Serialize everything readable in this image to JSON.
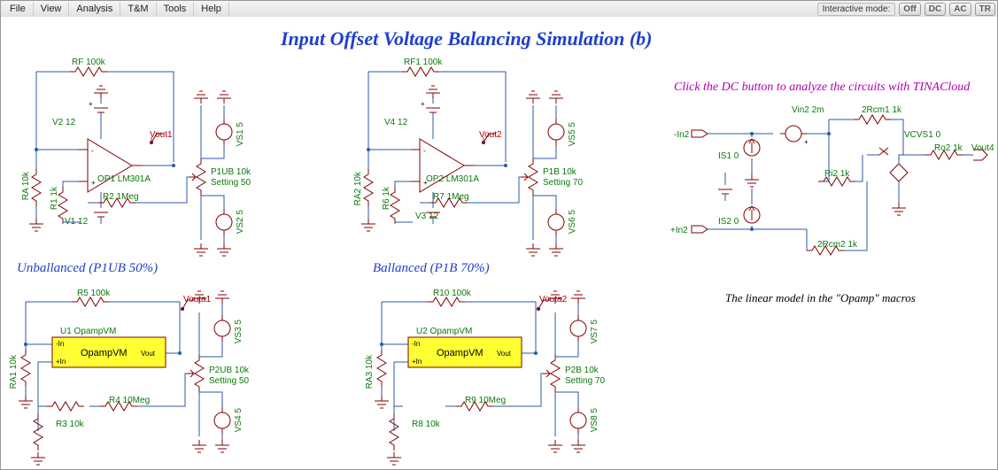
{
  "menu": {
    "items": [
      "File",
      "View",
      "Analysis",
      "T&M",
      "Tools",
      "Help"
    ]
  },
  "interactive": {
    "label": "Interactive mode:",
    "btn_off": "Off",
    "btn_dc": "DC",
    "btn_ac": "AC",
    "btn_tr": "TR"
  },
  "title": "Input Offset Voltage Balancing Simulation (b)",
  "sub_left": "Unballanced (P1UB 50%)",
  "sub_right": "Ballanced (P1B 70%)",
  "cta": "Click the DC button to analyze the circuits with TINACloud",
  "note": "The linear model in the \"Opamp\" macros",
  "q1": {
    "rf": "RF 100k",
    "v2": "V2 12",
    "v1": "V1 12",
    "op": "OP1 LM301A",
    "vout": "Vout1",
    "ra": "RA 10k",
    "r1": "R1 1k",
    "r2": "R2 1Meg",
    "p": "P1UB 10k",
    "pset": "Setting 50",
    "vs1": "VS1 5",
    "vs2": "VS2 5"
  },
  "q2": {
    "rf": "RF1 100k",
    "v4": "V4 12",
    "v3": "V3 12",
    "op": "OP2 LM301A",
    "vout": "Vout2",
    "ra": "RA2 10k",
    "r6": "R6 1k",
    "r7": "R7 1Meg",
    "p": "P1B 10k",
    "pset": "Setting 70",
    "vs5": "VS5 5",
    "vs6": "VS6 5"
  },
  "q3": {
    "r5": "R5 100k",
    "u": "U1 OpampVM",
    "vout": "Vouta1",
    "ra": "RA1 10k",
    "r4": "R4 10Meg",
    "r3": "R3 10k",
    "p": "P2UB 10k",
    "pset": "Setting 50",
    "vs3": "VS3 5",
    "vs4": "VS4 5",
    "macro": "OpampVM",
    "mpin": "Vout",
    "minm": "-In",
    "minp": "+In"
  },
  "q4": {
    "r10": "R10 100k",
    "u": "U2 OpampVM",
    "vout": "Vouta2",
    "ra": "RA3 10k",
    "r9": "R9 10Meg",
    "r8": "R8 10k",
    "p": "P2B 10k",
    "pset": "Setting 70",
    "vs7": "VS7 5",
    "vs8": "VS8 5",
    "macro": "OpampVM",
    "mpin": "Vout",
    "minm": "-In",
    "minp": "+In"
  },
  "lm": {
    "in2m": "-In2",
    "in2p": "+In2",
    "is1": "IS1 0",
    "is2": "IS2 0",
    "vin2": "Vin2 2m",
    "r2cm1": "2Rcm1 1k",
    "r2cm2": "2Rcm2 1k",
    "ri2": "Ri2 1k",
    "vcvs": "VCVS1 0",
    "ro2": "Ro2 1k",
    "vout4": "Vout4"
  }
}
